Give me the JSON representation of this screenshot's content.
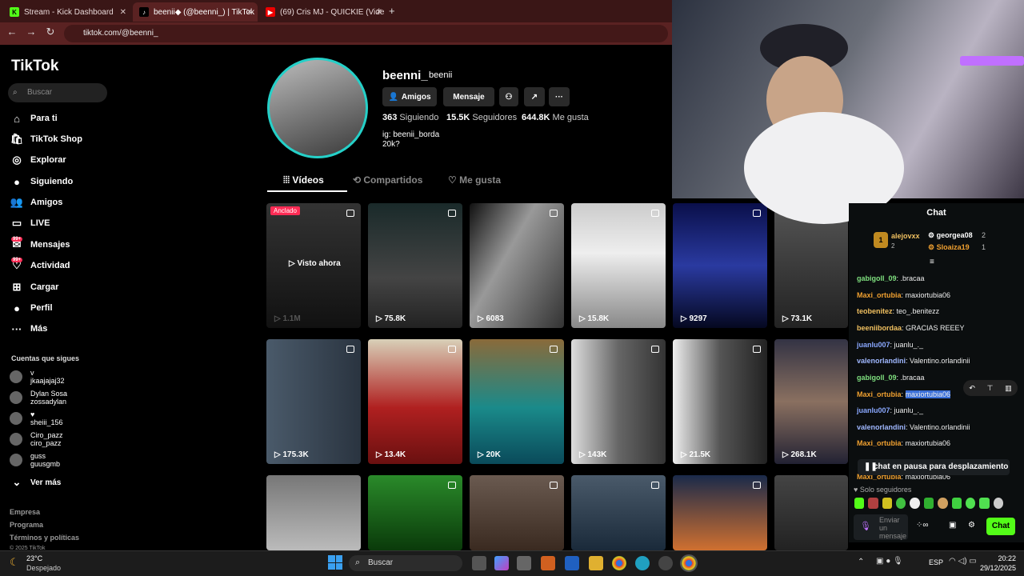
{
  "browser": {
    "tabs": [
      {
        "label": "Stream - Kick Dashboard",
        "icon": "kick-icon"
      },
      {
        "label": "beenii◆ (@beenni_) | TikTok",
        "icon": "tiktok-icon"
      },
      {
        "label": "(69) Cris MJ - QUICKIE (Vide",
        "icon": "youtube-icon"
      }
    ],
    "url": "tiktok.com/@beenni_"
  },
  "sidebar": {
    "logo": "TikTok",
    "search_placeholder": "Buscar",
    "nav": [
      "Para ti",
      "TikTok Shop",
      "Explorar",
      "Siguiendo",
      "Amigos",
      "LIVE",
      "Mensajes",
      "Actividad",
      "Cargar",
      "Perfil",
      "Más"
    ],
    "badge": "99+",
    "following_header": "Cuentas que sigues",
    "following": [
      {
        "name": "v",
        "handle": "jkaajajaj32"
      },
      {
        "name": "Dylan Sosa",
        "handle": "zossadylan"
      },
      {
        "name": "♥",
        "handle": "sheiii_156"
      },
      {
        "name": "Ciro_pazz",
        "handle": "ciro_pazz"
      },
      {
        "name": "guss",
        "handle": "guusgmb"
      }
    ],
    "see_more": "Ver más",
    "footer": [
      "Empresa",
      "Programa",
      "Términos y políticas",
      "© 2025 TikTok"
    ]
  },
  "profile": {
    "username": "beenni_",
    "nickname": "beenii",
    "buttons": {
      "friends": "Amigos",
      "message": "Mensaje"
    },
    "following_count": "363",
    "following_label": "Siguiendo",
    "followers_count": "15.5K",
    "followers_label": "Seguidores",
    "likes_count": "644.8K",
    "likes_label": "Me gusta",
    "bio_lines": [
      "ig: beenii_borda",
      "20k?"
    ],
    "tabs": [
      "Vídeos",
      "Compartidos",
      "Me gusta"
    ]
  },
  "videos": {
    "pinned_label": "Anclado",
    "watch_label": "Visto ahora",
    "counts": [
      "1.1M",
      "75.8K",
      "6083",
      "15.8K",
      "9297",
      "73.1K",
      "175.3K",
      "13.4K",
      "20K",
      "143K",
      "21.5K",
      "268.1K"
    ]
  },
  "chat": {
    "title": "Chat",
    "leaders": [
      {
        "rank": "1",
        "name": "alejovxx",
        "count": "2"
      },
      {
        "name": "georgea08",
        "count": "2"
      },
      {
        "name": "Sloaiza19",
        "count": "1"
      }
    ],
    "messages": [
      {
        "user": "gabigoll_09",
        "text": ".bracaa",
        "color": "#7fe07f"
      },
      {
        "user": "Maxi_ortubia",
        "text": "maxiortubia06",
        "color": "#f0a030"
      },
      {
        "user": "teobenitez",
        "text": "teo_.benitezz",
        "color": "#f0c060"
      },
      {
        "user": "beeniibordaa",
        "text": "GRACIAS REEEY",
        "color": "#f0c060"
      },
      {
        "user": "juanlu007",
        "text": "juanlu_._",
        "color": "#8aa8ff"
      },
      {
        "user": "valenorlandini",
        "text": "Valentino.orlandinii",
        "color": "#a0b8ff"
      },
      {
        "user": "gabigoll_09",
        "text": ".bracaa",
        "color": "#7fe07f"
      },
      {
        "user": "Maxi_ortubia",
        "text": "maxiortubia06",
        "color": "#f0a030"
      },
      {
        "user": "juanlu007",
        "text": "juanlu_._",
        "color": "#8aa8ff"
      },
      {
        "user": "valenorlandini",
        "text": "Valentino.orlandinii",
        "color": "#a0b8ff"
      },
      {
        "user": "Maxi_ortubia",
        "text": "maxiortubia06",
        "color": "#f0a030"
      },
      {
        "user": "Maxi_ortubia",
        "text": "maxiortubia06",
        "color": "#f0a030"
      }
    ],
    "paused": "chat en pausa para desplazamiento",
    "followers_only": "Solo seguidores",
    "input_placeholder": "Enviar un mensaje",
    "send": "Chat"
  },
  "taskbar": {
    "weather_temp": "23°C",
    "weather_desc": "Despejado",
    "search": "Buscar",
    "lang": "ESP",
    "time": "20:22",
    "date": "29/12/2025"
  }
}
